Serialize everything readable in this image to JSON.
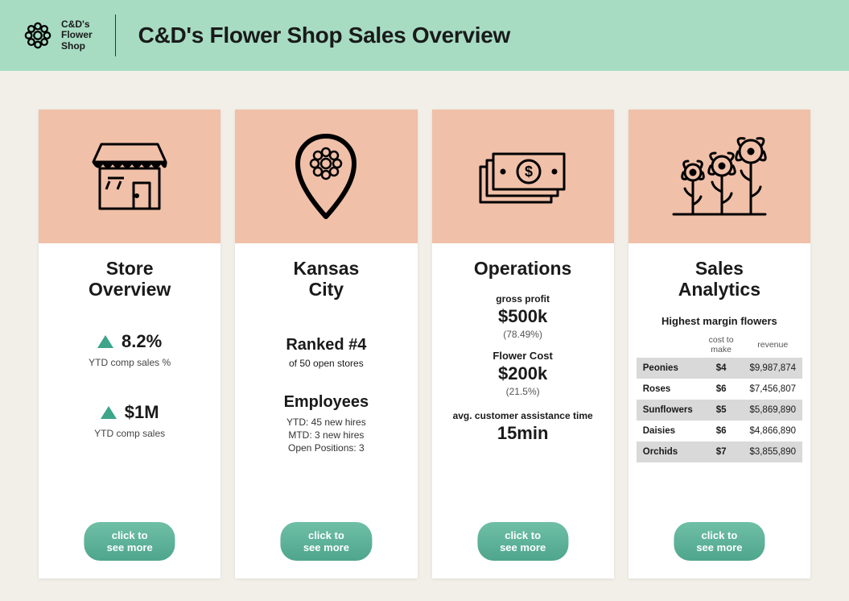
{
  "header": {
    "brand_line1": "C&D's",
    "brand_line2": "Flower",
    "brand_line3": "Shop",
    "title": "C&D's Flower Shop Sales Overview"
  },
  "cards": {
    "store": {
      "title_line1": "Store",
      "title_line2": "Overview",
      "stat1_value": "8.2%",
      "stat1_label": "YTD comp sales %",
      "stat2_value": "$1M",
      "stat2_label": "YTD comp sales",
      "button": "click to see more"
    },
    "city": {
      "title_line1": "Kansas",
      "title_line2": "City",
      "rank": "Ranked #4",
      "rank_sub": "of 50 open stores",
      "employees_heading": "Employees",
      "emp_line1": "YTD: 45 new hires",
      "emp_line2": "MTD: 3 new hires",
      "emp_line3": "Open Positions: 3",
      "button": "click to see more"
    },
    "ops": {
      "title": "Operations",
      "gp_label": "gross profit",
      "gp_value": "$500k",
      "gp_pct": "(78.49%)",
      "fc_label": "Flower Cost",
      "fc_value": "$200k",
      "fc_pct": "(21.5%)",
      "avg_label": "avg. customer assistance time",
      "avg_value": "15min",
      "button": "click to see more"
    },
    "analytics": {
      "title_line1": "Sales",
      "title_line2": "Analytics",
      "subtitle": "Highest margin flowers",
      "th_cost": "cost to make",
      "th_rev": "revenue",
      "rows": [
        {
          "name": "Peonies",
          "cost": "$4",
          "revenue": "$9,987,874"
        },
        {
          "name": "Roses",
          "cost": "$6",
          "revenue": "$7,456,807"
        },
        {
          "name": "Sunflowers",
          "cost": "$5",
          "revenue": "$5,869,890"
        },
        {
          "name": "Daisies",
          "cost": "$6",
          "revenue": "$4,866,890"
        },
        {
          "name": "Orchids",
          "cost": "$7",
          "revenue": "$3,855,890"
        }
      ],
      "button": "click to see more"
    }
  },
  "chart_data": {
    "type": "table",
    "title": "Highest margin flowers",
    "columns": [
      "flower",
      "cost_to_make_usd",
      "revenue_usd"
    ],
    "rows": [
      [
        "Peonies",
        4,
        9987874
      ],
      [
        "Roses",
        6,
        7456807
      ],
      [
        "Sunflowers",
        5,
        5869890
      ],
      [
        "Daisies",
        6,
        4866890
      ],
      [
        "Orchids",
        7,
        3855890
      ]
    ]
  }
}
